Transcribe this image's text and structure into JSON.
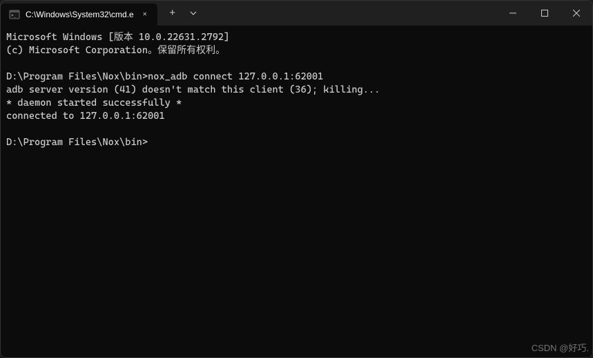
{
  "titlebar": {
    "tab_title": "C:\\Windows\\System32\\cmd.e",
    "tab_close": "✕",
    "new_tab": "+",
    "dropdown": "⌄"
  },
  "window_controls": {
    "minimize": "—",
    "maximize": "☐",
    "close": "✕"
  },
  "terminal": {
    "lines": {
      "l0": "Microsoft Windows [版本 10.0.22631.2792]",
      "l1": "(c) Microsoft Corporation。保留所有权利。",
      "l2": "",
      "l3": "D:\\Program Files\\Nox\\bin>nox_adb connect 127.0.0.1:62001",
      "l4": "adb server version (41) doesn't match this client (36); killing...",
      "l5": "* daemon started successfully *",
      "l6": "connected to 127.0.0.1:62001",
      "l7": "",
      "l8": "D:\\Program Files\\Nox\\bin>"
    }
  },
  "watermark": "CSDN @好巧."
}
